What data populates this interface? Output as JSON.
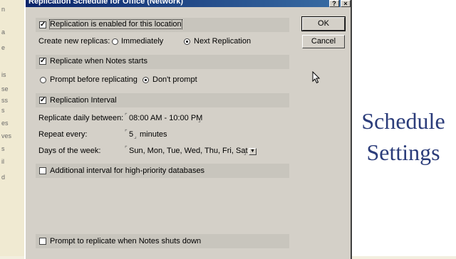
{
  "window": {
    "title": "Replication Schedule for Office (Network)",
    "help_glyph": "?",
    "close_glyph": "×"
  },
  "buttons": {
    "ok": "OK",
    "cancel": "Cancel"
  },
  "replication_enabled": {
    "label": "Replication is enabled for this location",
    "checked": true
  },
  "create_new": {
    "label": "Create new replicas:",
    "options": [
      "Immediately",
      "Next Replication"
    ],
    "selected": "Next Replication"
  },
  "replicate_on_start": {
    "label": "Replicate when Notes starts",
    "checked": true
  },
  "prompt": {
    "options": [
      "Prompt before replicating",
      "Don't prompt"
    ],
    "selected": "Don't prompt"
  },
  "interval": {
    "label": "Replication Interval",
    "checked": true,
    "daily_label": "Replicate daily between:",
    "daily_value": "08:00 AM - 10:00 PM",
    "repeat_label": "Repeat every:",
    "repeat_value": "5",
    "repeat_unit": "minutes",
    "days_label": "Days of the week:",
    "days_value": "Sun, Mon, Tue, Wed, Thu, Fri, Sat"
  },
  "high_priority": {
    "label": "Additional interval for high-priority databases",
    "checked": false
  },
  "shutdown": {
    "label": "Prompt to replicate when Notes shuts down",
    "checked": false
  },
  "slide": {
    "title_line1": "Schedule",
    "title_line2": "Settings",
    "title_color": "#2b3c7a"
  },
  "background_fragments": [
    "n",
    "a",
    "e",
    "is",
    "se",
    "ss",
    "s",
    "es",
    "ves",
    "s",
    "il",
    "d"
  ]
}
